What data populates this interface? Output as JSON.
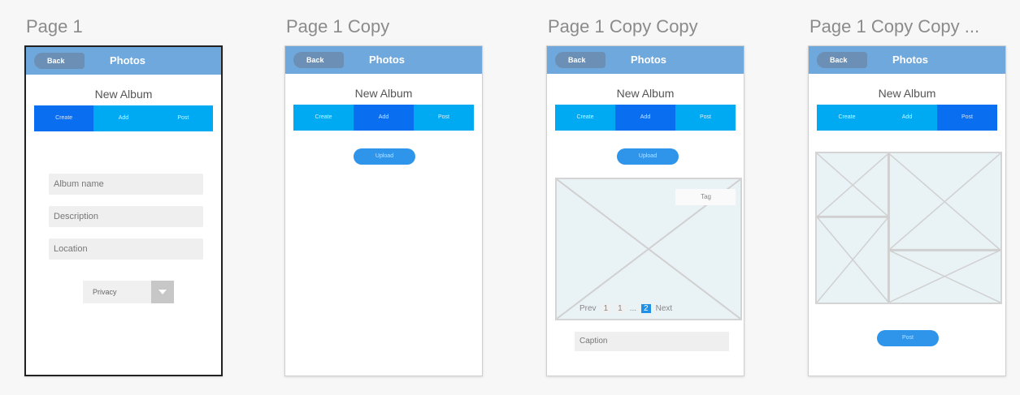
{
  "pages": [
    {
      "title": "Page 1"
    },
    {
      "title": "Page 1 Copy"
    },
    {
      "title": "Page 1 Copy Copy"
    },
    {
      "title": "Page 1 Copy Copy ..."
    }
  ],
  "mockup": {
    "back_label": "Back",
    "bar_title": "Photos",
    "album_title": "New Album",
    "tabs": [
      "Create",
      "Add",
      "Post"
    ],
    "upload_label": "Upload",
    "post_label": "Post",
    "tag_label": "Tag",
    "caption_label": "Caption"
  },
  "form": {
    "album_name": "Album name",
    "description": "Description",
    "location": "Location",
    "privacy": "Privacy"
  },
  "pager": {
    "prev": "Prev",
    "p1": "1",
    "p2": "1",
    "ellipsis": "...",
    "p3": "2",
    "next": "Next"
  }
}
